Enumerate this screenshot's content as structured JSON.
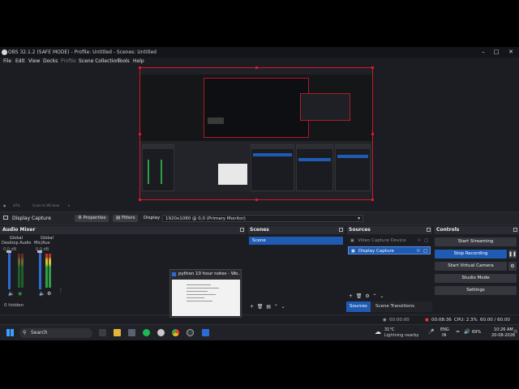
{
  "window": {
    "title": "OBS 32.1.2 (SAFE MODE) - Profile: Untitled - Scenes: Untitled",
    "controls": [
      "–",
      "□",
      "✕"
    ]
  },
  "menu": [
    "File",
    "Edit",
    "View",
    "Docks",
    "Profile",
    "Scene Collection",
    "Tools",
    "Help"
  ],
  "preview_tools": {
    "zoom": "40%",
    "scale_label": "Scale to Window"
  },
  "source_toolbar": {
    "source_name": "Display Capture",
    "properties": "Properties",
    "filters": "Filters",
    "display_label": "Display",
    "display_value": "1920x1080 @ 0,0 (Primary Monitor)"
  },
  "audio_mixer": {
    "title": "Audio Mixer",
    "channels": [
      {
        "scope": "Global",
        "name": "Desktop Audio",
        "db": "0.0 dB",
        "level": 0.0
      },
      {
        "scope": "Global",
        "name": "Mic/Aux",
        "db": "0.0 dB",
        "level": 0.72
      }
    ],
    "hidden": "0 hidden"
  },
  "scenes": {
    "title": "Scenes",
    "items": [
      "Scene"
    ]
  },
  "sources": {
    "title": "Sources",
    "items": [
      "Video Capture Device",
      "Display Capture"
    ],
    "tabs": [
      "Sources",
      "Scene Transitions"
    ]
  },
  "controls": {
    "title": "Controls",
    "buttons": [
      "Start Streaming",
      "Stop Recording",
      "Start Virtual Camera",
      "Studio Mode",
      "Settings"
    ]
  },
  "status": {
    "rec_time": "00:08:36",
    "cpu": "CPU: 2.3%",
    "fps": "60.00 / 60.00 FPS",
    "stream_time": "00:00:00"
  },
  "thumbnail": {
    "title": "python 10 hour notes - Wo..."
  },
  "taskbar": {
    "search": "Search",
    "weather_temp": "31°C",
    "weather_desc": "Lightning nearby",
    "lang": "ENG",
    "region": "IN",
    "battery": "69%",
    "time": "10:26 AM",
    "date": "20-08-2026"
  },
  "colors": {
    "accent": "#1f5bb3",
    "record_red": "#d0162b",
    "panel": "#1c1d22"
  }
}
